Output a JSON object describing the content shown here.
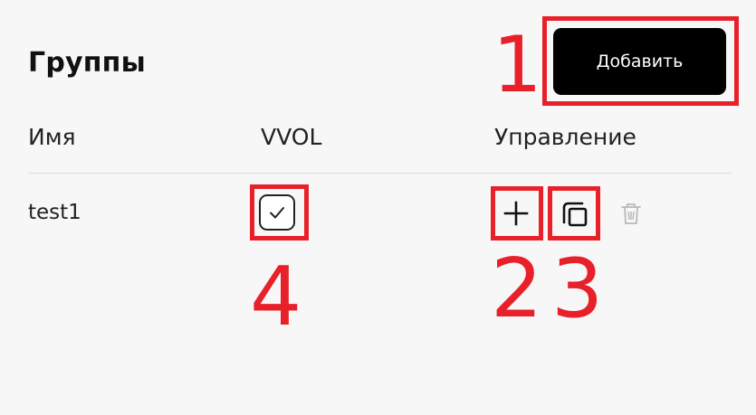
{
  "panel": {
    "title": "Группы",
    "add_button_label": "Добавить"
  },
  "table": {
    "columns": [
      "Имя",
      "VVOL",
      "Управление"
    ],
    "rows": [
      {
        "name": "test1",
        "vvol_checked": true,
        "actions": [
          "plus-icon",
          "copy-icon",
          "trash-icon"
        ]
      }
    ]
  },
  "annotations": {
    "labels": [
      "1",
      "2",
      "3",
      "4"
    ],
    "color": "#e8202a"
  }
}
